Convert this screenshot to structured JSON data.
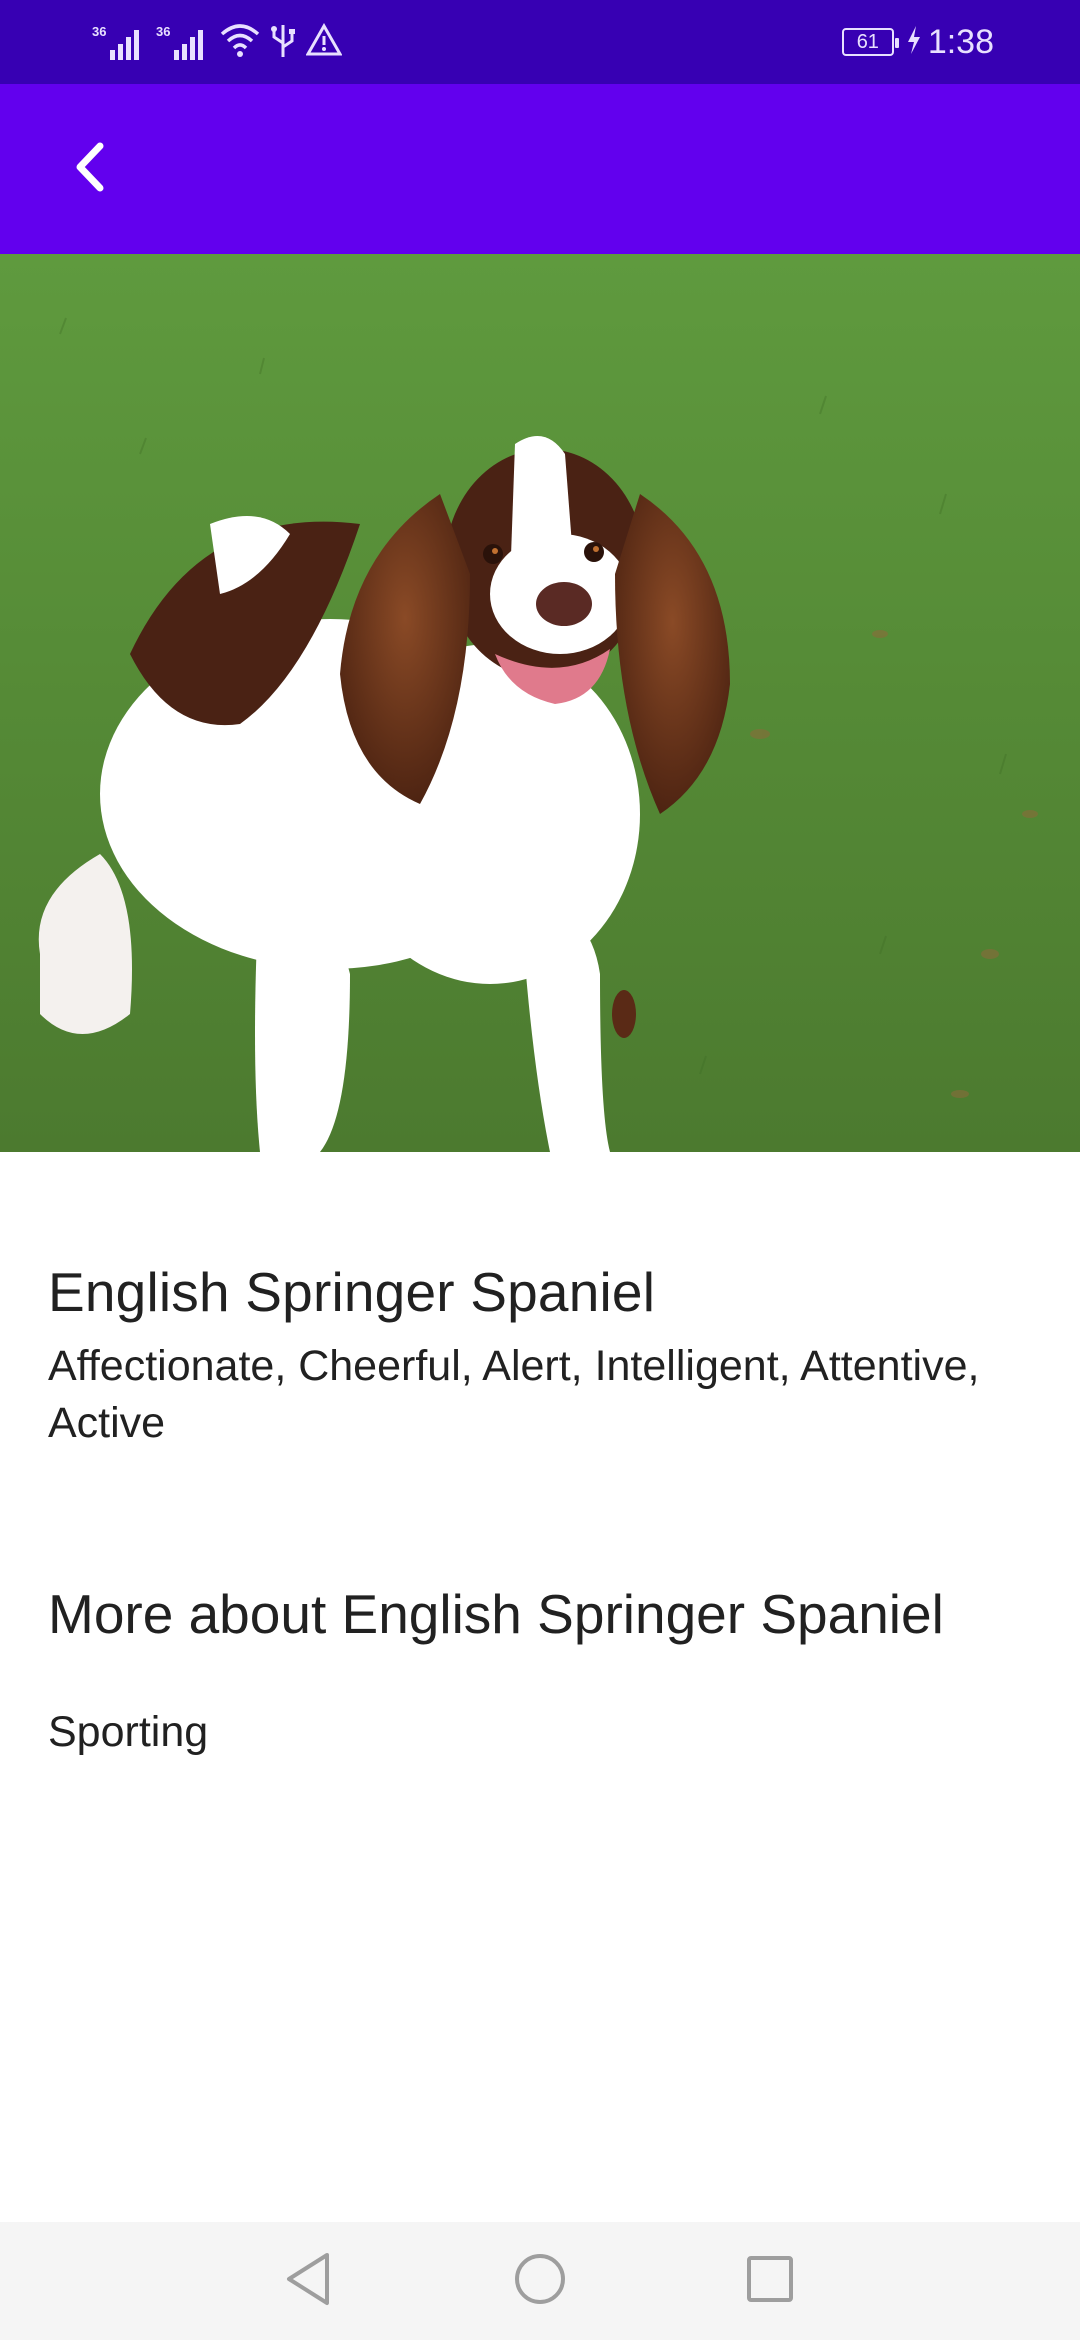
{
  "status_bar": {
    "signal_1_label": "36",
    "signal_2_label": "36",
    "battery_level": "61",
    "time": "1:38",
    "icons": [
      "signal-icon",
      "signal-icon",
      "wifi-icon",
      "usb-icon",
      "warning-icon",
      "battery-icon",
      "charging-icon"
    ]
  },
  "app_bar": {
    "back_icon": "chevron-left-icon",
    "background_color": "#6200ee",
    "status_color": "#3700b3"
  },
  "hero": {
    "image": "dog-photo"
  },
  "breed": {
    "name": "English Springer Spaniel",
    "temperament": "Affectionate, Cheerful, Alert, Intelligent, Attentive, Active"
  },
  "more": {
    "title": "More about English Springer Spaniel",
    "group": "Sporting"
  },
  "nav_bar": {
    "icons": [
      "back-triangle-icon",
      "home-circle-icon",
      "recents-square-icon"
    ]
  }
}
